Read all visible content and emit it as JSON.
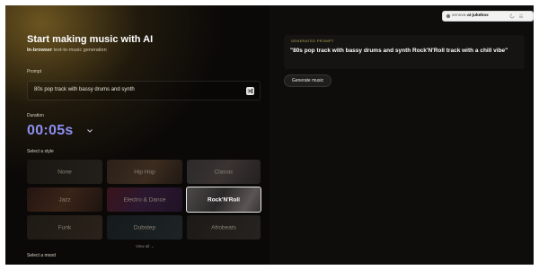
{
  "app": {
    "title": "Start making music with AI",
    "subtitle_bold": "In-browser",
    "subtitle_rest": " text-to-music generation"
  },
  "prompt": {
    "label": "Prompt",
    "value": "80s pop track with bassy drums and synth",
    "shuffle_icon": "shuffle-icon"
  },
  "duration": {
    "label": "Duration",
    "value": "00:05s"
  },
  "style": {
    "label": "Select a style",
    "options": [
      {
        "label": "None",
        "selected": false
      },
      {
        "label": "Hip Hop",
        "selected": false
      },
      {
        "label": "Classic",
        "selected": false
      },
      {
        "label": "Jazz",
        "selected": false
      },
      {
        "label": "Electro & Dance",
        "selected": false
      },
      {
        "label": "Rock'N'Roll",
        "selected": true
      },
      {
        "label": "Funk",
        "selected": false
      },
      {
        "label": "Dubstep",
        "selected": false
      },
      {
        "label": "Afrobeats",
        "selected": false
      }
    ],
    "view_all": "View all"
  },
  "mood": {
    "label": "Select a mood"
  },
  "generated": {
    "label": "GENERATED PROMPT",
    "text": "\"80s pop track with bassy drums and synth Rock'N'Roll track with a chill vibe\"",
    "button": "Generate music"
  },
  "browser": {
    "url_prefix": "xenova-",
    "url_bold": "ai-jukebox",
    "colors": {
      "accent": "#8d8ff0",
      "gold": "#bda95c"
    }
  }
}
